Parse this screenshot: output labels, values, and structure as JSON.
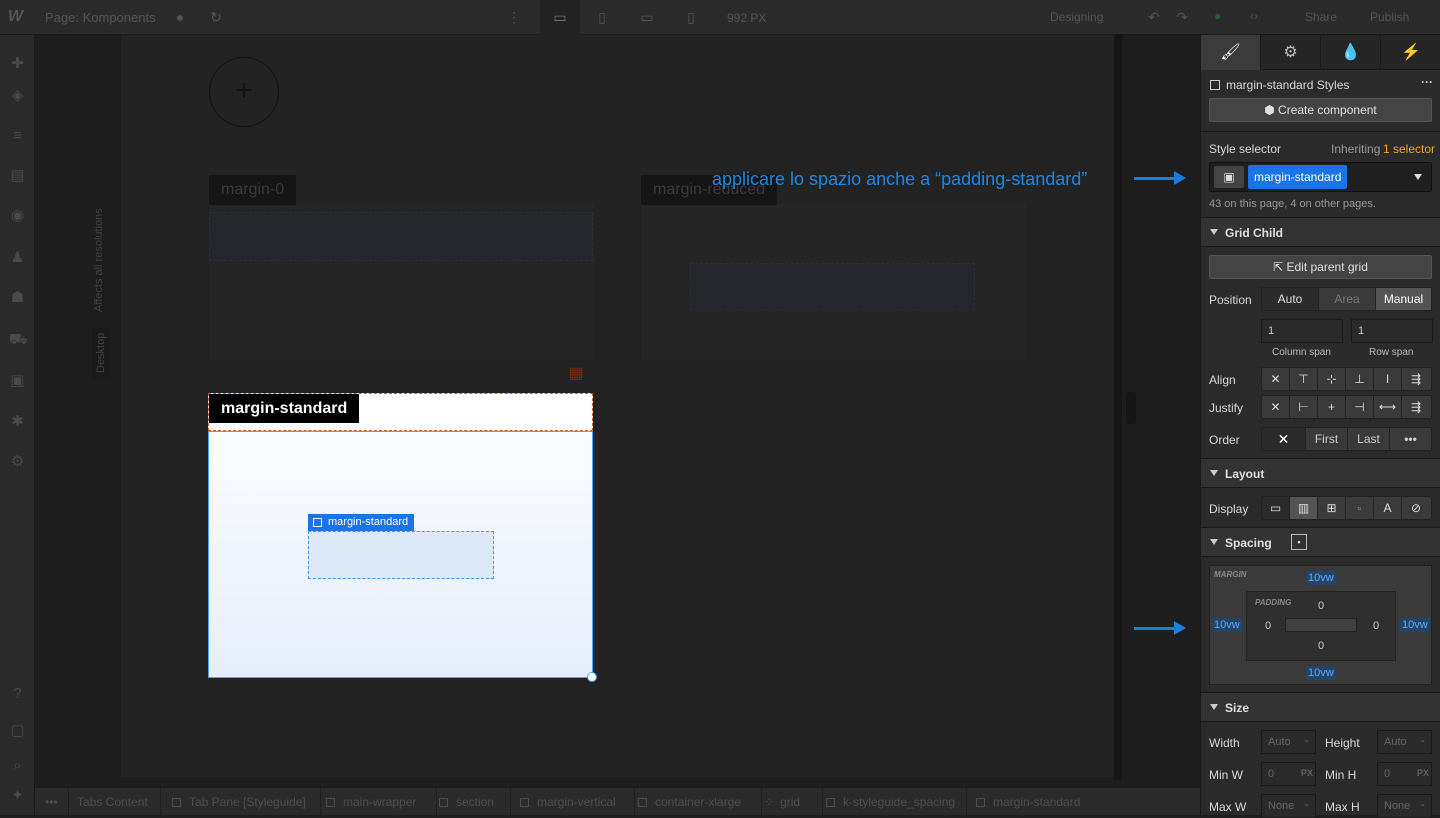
{
  "topbar": {
    "logo": "W",
    "page_name": "Page: Komponents",
    "canvas_width": "992 PX",
    "mode": "Designing",
    "share": "Share",
    "publish": "Publish"
  },
  "canvas": {
    "breakpoint_label": "Desktop",
    "affects_label": "Affects all resolutions",
    "add_symbol": "+",
    "tags": {
      "margin_0": "margin-0",
      "margin_reduced": "margin-reduced",
      "margin_standard": "margin-standard",
      "inner_selected": "margin-standard"
    }
  },
  "annotation": {
    "text": "applicare lo spazio anche a “padding-standard”"
  },
  "breadcrumb": {
    "items": [
      "Tabs Content",
      "Tab Pane [Styleguide]",
      "main-wrapper",
      "section",
      "margin-vertical",
      "container-xlarge",
      "grid",
      "k-styleguide_spacing",
      "margin-standard"
    ]
  },
  "panel": {
    "tabs": [
      "style-brush-icon",
      "settings-gear-icon",
      "interactions-drops-icon",
      "lightning-icon"
    ],
    "styles_title": "margin-standard Styles",
    "create_component": "Create component",
    "style_selector_label": "Style selector",
    "inheriting_prefix": "Inheriting",
    "inheriting_count": "1 selector",
    "selector_value": "margin-standard",
    "usage_text": "43 on this page, 4 on other pages.",
    "grid_child": {
      "title": "Grid Child",
      "edit_parent": "Edit parent grid",
      "position_label": "Position",
      "position_options": [
        "Auto",
        "Area",
        "Manual"
      ],
      "column_span_value": "1",
      "row_span_value": "1",
      "column_span_label": "Column span",
      "row_span_label": "Row span",
      "align_label": "Align",
      "justify_label": "Justify",
      "order_label": "Order",
      "order_first": "First",
      "order_last": "Last",
      "order_more": "•••"
    },
    "layout": {
      "title": "Layout",
      "display_label": "Display"
    },
    "spacing": {
      "title": "Spacing",
      "margin_label": "MARGIN",
      "padding_label": "PADDING",
      "margin_top": "10vw",
      "margin_right": "10vw",
      "margin_bottom": "10vw",
      "margin_left": "10vw",
      "padding_top": "0",
      "padding_right": "0",
      "padding_bottom": "0",
      "padding_left": "0"
    },
    "size": {
      "title": "Size",
      "width_label": "Width",
      "width_value": "Auto",
      "height_label": "Height",
      "height_value": "Auto",
      "minw_label": "Min W",
      "minw_value": "0",
      "minh_label": "Min H",
      "minh_value": "0",
      "maxw_label": "Max W",
      "maxw_value": "None",
      "maxh_label": "Max H",
      "maxh_value": "None",
      "unit_px": "PX",
      "unit_dash": "-"
    }
  }
}
